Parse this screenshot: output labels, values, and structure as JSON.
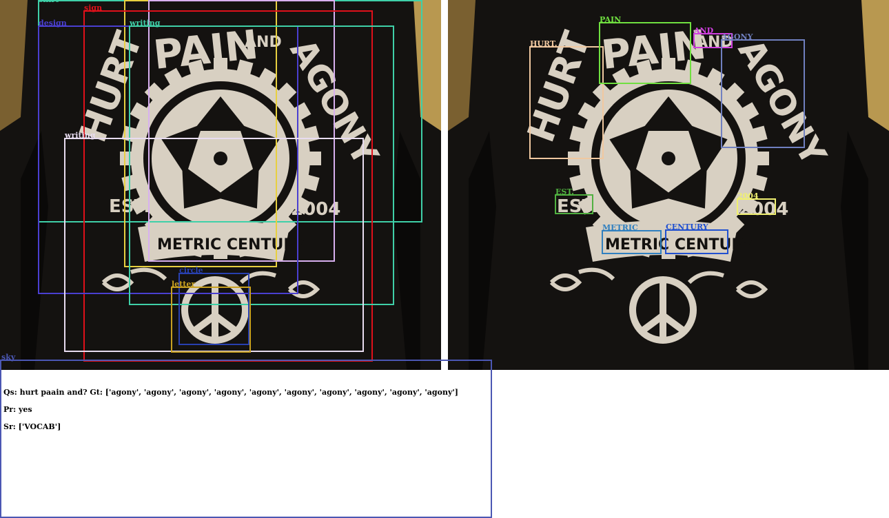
{
  "left_labels": {
    "shirt": "shirt",
    "sign": "sign",
    "design": "design",
    "writing_a": "writing",
    "writing_b": "writing",
    "circle": "circle",
    "letter": "letter",
    "sky": "sky"
  },
  "right_labels": {
    "hurt": "HURT.",
    "pain": "PAIN",
    "and": "AND",
    "agony": "AGONY",
    "est": "EST.",
    "year": "2004",
    "metric": "METRIC",
    "century": "CENTURY"
  },
  "shirt_print": {
    "hurt": "HURT",
    "pain": "PAIN",
    "and": "AND",
    "agony": "AGONY",
    "est": "EST.",
    "year": "2004",
    "banner": "METRIC CENTURY"
  },
  "qa": {
    "question": "Qs: hurt paain and? Gt: ['agony', 'agony', 'agony', 'agony', 'agony', 'agony', 'agony', 'agony', 'agony', 'agony']",
    "prediction": "Pr: yes",
    "source": "Sr: ['VOCAB']"
  },
  "colors": {
    "teal": "#3fd0a8",
    "red": "#e0101a",
    "indigo": "#4a3fd0",
    "yellow": "#e8d040",
    "lavender": "#d8b0f0",
    "white": "#e8dcf0",
    "navy": "#2840b0",
    "gold": "#c8a020",
    "bottom": "#4b57b3",
    "peach": "#f0c8a0",
    "green": "#70e040",
    "magenta": "#d040e0",
    "slate": "#7080c0",
    "olive_green": "#50b040",
    "lime": "#f0f070",
    "blue1": "#3080c0",
    "blue2": "#2050d0"
  }
}
